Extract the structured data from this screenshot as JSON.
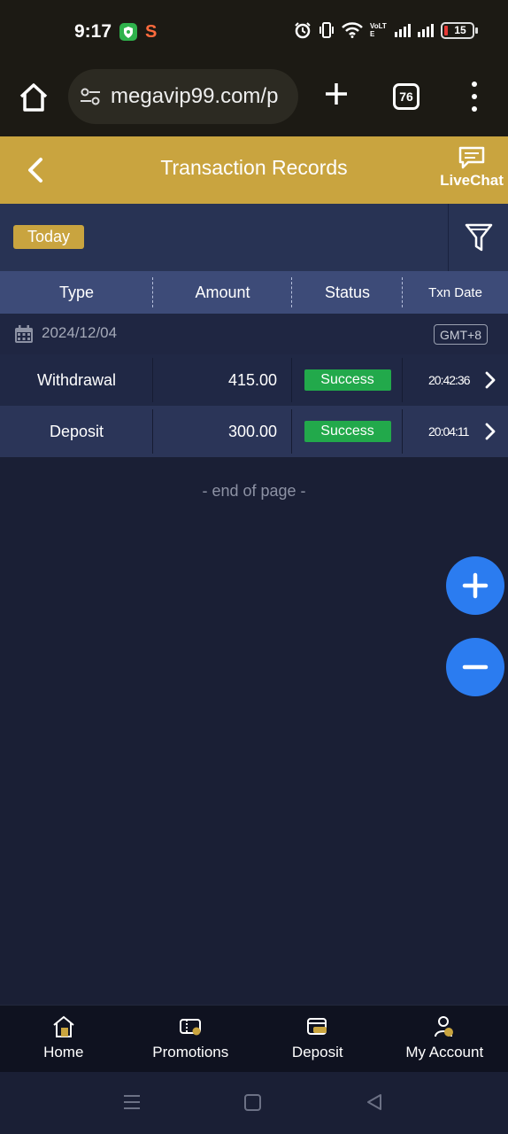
{
  "status_bar": {
    "time": "9:17",
    "network_label": "VoLTE",
    "battery_level": "15"
  },
  "browser": {
    "url": "megavip99.com/p",
    "tab_count": "76"
  },
  "header": {
    "title": "Transaction Records",
    "livechat_label": "LiveChat"
  },
  "filter": {
    "today_label": "Today"
  },
  "table": {
    "columns": [
      "Type",
      "Amount",
      "Status",
      "Txn Date"
    ],
    "date_group": "2024/12/04",
    "timezone": "GMT+8",
    "rows": [
      {
        "type": "Withdrawal",
        "amount": "415.00",
        "status": "Success",
        "time": "20:42:36"
      },
      {
        "type": "Deposit",
        "amount": "300.00",
        "status": "Success",
        "time": "20:04:11"
      }
    ]
  },
  "end_of_page": "- end of page -",
  "bottom_nav": [
    {
      "label": "Home",
      "icon": "home-icon"
    },
    {
      "label": "Promotions",
      "icon": "promotions-icon"
    },
    {
      "label": "Deposit",
      "icon": "deposit-icon"
    },
    {
      "label": "My Account",
      "icon": "account-icon"
    }
  ],
  "colors": {
    "gold": "#c9a43f",
    "background": "#1a1f35",
    "success": "#22a94b",
    "fab": "#2b7cf0"
  }
}
